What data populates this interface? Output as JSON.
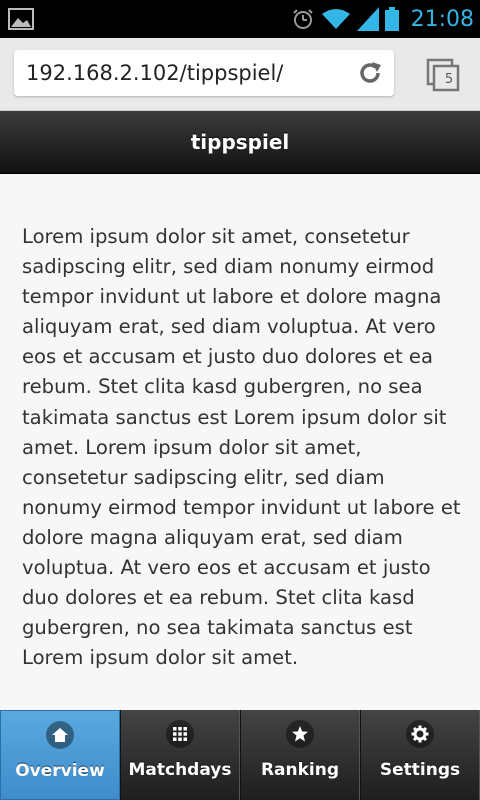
{
  "status_bar": {
    "time": "21:08",
    "icons": [
      "image-notification-icon",
      "alarm-icon",
      "wifi-icon",
      "signal-icon",
      "battery-icon"
    ]
  },
  "browser": {
    "url": "192.168.2.102/tippspiel/",
    "tab_count": "5"
  },
  "page": {
    "title": "tippspiel",
    "body_text": "Lorem ipsum dolor sit amet, consetetur sadipscing elitr, sed diam nonumy eirmod tempor invidunt ut labore et dolore magna aliquyam erat, sed diam voluptua. At vero eos et accusam et justo duo dolores et ea rebum. Stet clita kasd gubergren, no sea takimata sanctus est Lorem ipsum dolor sit amet. Lorem ipsum dolor sit amet, consetetur sadipscing elitr, sed diam nonumy eirmod tempor invidunt ut labore et dolore magna aliquyam erat, sed diam voluptua. At vero eos et accusam et justo duo dolores et ea rebum. Stet clita kasd gubergren, no sea takimata sanctus est Lorem ipsum dolor sit amet."
  },
  "navbar": {
    "items": [
      {
        "label": "Overview",
        "icon": "home-icon",
        "active": true
      },
      {
        "label": "Matchdays",
        "icon": "grid-icon",
        "active": false
      },
      {
        "label": "Ranking",
        "icon": "star-icon",
        "active": false
      },
      {
        "label": "Settings",
        "icon": "gear-icon",
        "active": false
      }
    ]
  },
  "colors": {
    "status_accent": "#33b5e5",
    "nav_active": "#4a9ad6",
    "header_dark": "#1a1a1a"
  }
}
